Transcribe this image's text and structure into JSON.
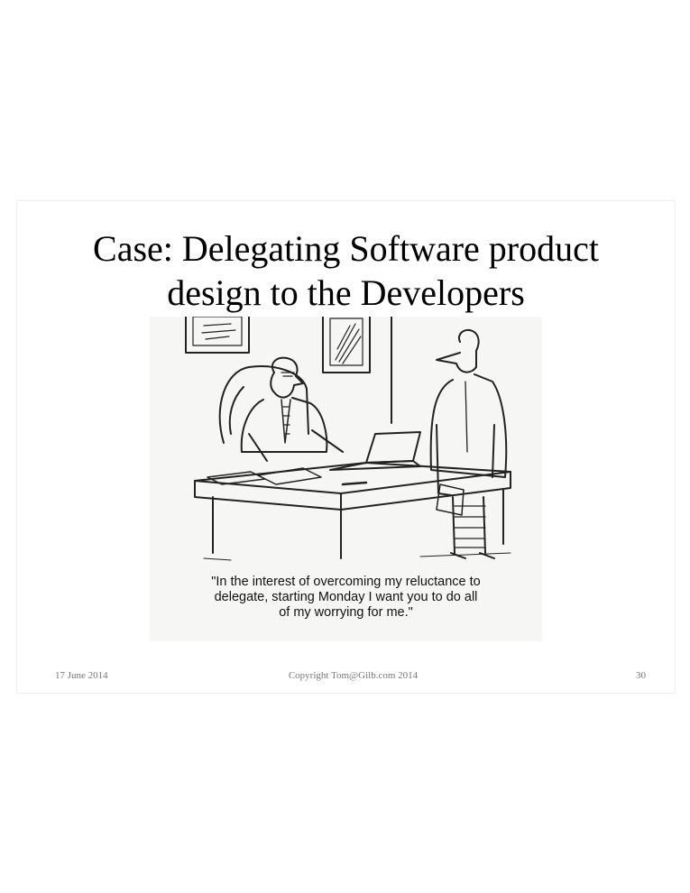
{
  "slide": {
    "title_line1": "Case: Delegating Software product",
    "title_line2": "design to the Developers",
    "cartoon": {
      "caption_line1": "\"In the interest of overcoming my reluctance to",
      "caption_line2": "delegate, starting Monday I want you to do all",
      "caption_line3": "of my worrying for me.\""
    },
    "footer": {
      "date": "17 June 2014",
      "copyright": "Copyright Tom@Gilb.com 2014",
      "page_number": "30"
    }
  }
}
